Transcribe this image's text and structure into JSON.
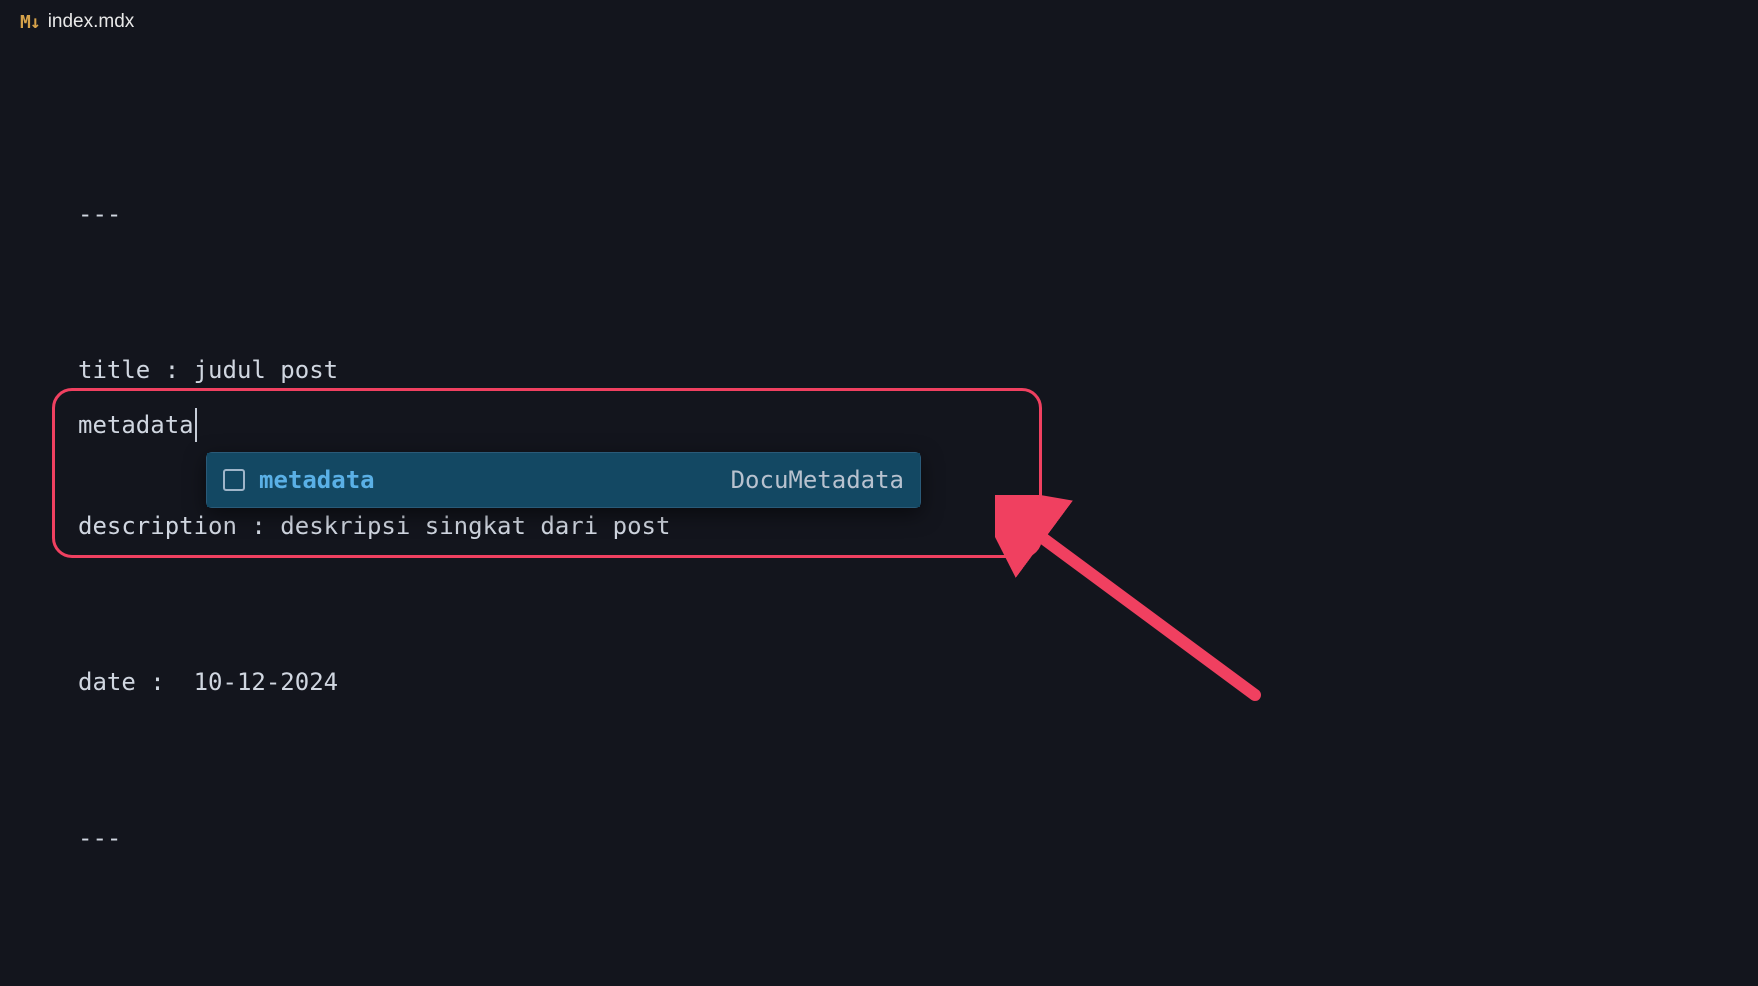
{
  "tab": {
    "icon_text": "M↓",
    "title": "index.mdx"
  },
  "editor": {
    "lines": [
      "---",
      "title : judul post",
      "description : deskripsi singkat dari post",
      "date :  10-12-2024",
      "---"
    ],
    "typed_word": "metadata"
  },
  "autocomplete": {
    "items": [
      {
        "label": "metadata",
        "detail": "DocuMetadata"
      }
    ]
  },
  "annotation": {
    "color": "#f04060"
  }
}
